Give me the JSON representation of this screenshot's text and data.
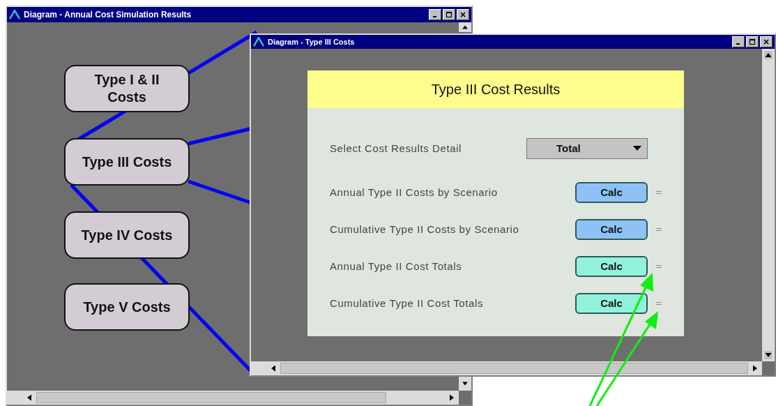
{
  "back_window": {
    "title": "Diagram - Annual Cost Simulation Results",
    "nodes": [
      {
        "label": "Type I & II Costs"
      },
      {
        "label": "Type III Costs"
      },
      {
        "label": "Type IV Costs"
      },
      {
        "label": "Type V Costs"
      }
    ]
  },
  "front_window": {
    "title": "Diagram - Type III Costs",
    "panel": {
      "title": "Type III Cost Results",
      "detail": {
        "label": "Select Cost Results Detail",
        "value": "Total"
      },
      "rows": [
        {
          "label": "Annual Type II Costs by Scenario",
          "button": "Calc",
          "color": "#8ec2f6"
        },
        {
          "label": "Cumulative Type II Costs by Scenario",
          "button": "Calc",
          "color": "#8ec2f6"
        },
        {
          "label": "Annual Type II Cost Totals",
          "button": "Calc",
          "color": "#92f2dc"
        },
        {
          "label": "Cumulative Type II Cost Totals",
          "button": "Calc",
          "color": "#92f2dc"
        }
      ]
    }
  }
}
